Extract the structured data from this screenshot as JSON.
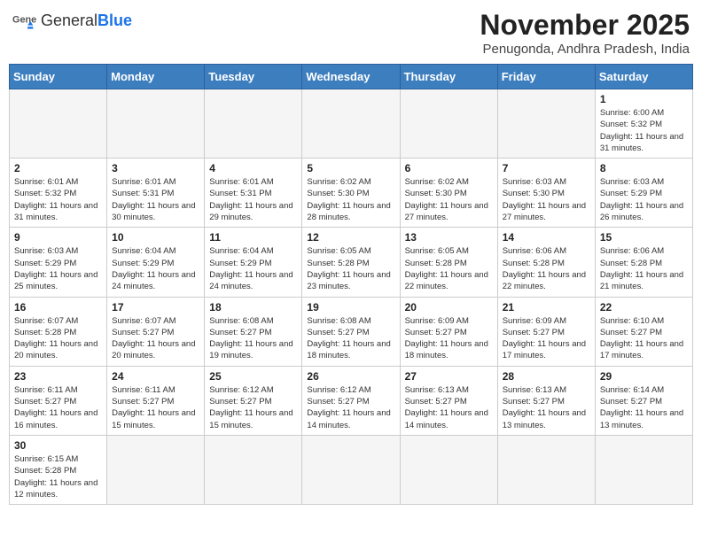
{
  "header": {
    "logo_general": "General",
    "logo_blue": "Blue",
    "month_title": "November 2025",
    "subtitle": "Penugonda, Andhra Pradesh, India"
  },
  "weekdays": [
    "Sunday",
    "Monday",
    "Tuesday",
    "Wednesday",
    "Thursday",
    "Friday",
    "Saturday"
  ],
  "weeks": [
    [
      {
        "day": null,
        "info": ""
      },
      {
        "day": null,
        "info": ""
      },
      {
        "day": null,
        "info": ""
      },
      {
        "day": null,
        "info": ""
      },
      {
        "day": null,
        "info": ""
      },
      {
        "day": null,
        "info": ""
      },
      {
        "day": "1",
        "info": "Sunrise: 6:00 AM\nSunset: 5:32 PM\nDaylight: 11 hours and 31 minutes."
      }
    ],
    [
      {
        "day": "2",
        "info": "Sunrise: 6:01 AM\nSunset: 5:32 PM\nDaylight: 11 hours and 31 minutes."
      },
      {
        "day": "3",
        "info": "Sunrise: 6:01 AM\nSunset: 5:31 PM\nDaylight: 11 hours and 30 minutes."
      },
      {
        "day": "4",
        "info": "Sunrise: 6:01 AM\nSunset: 5:31 PM\nDaylight: 11 hours and 29 minutes."
      },
      {
        "day": "5",
        "info": "Sunrise: 6:02 AM\nSunset: 5:30 PM\nDaylight: 11 hours and 28 minutes."
      },
      {
        "day": "6",
        "info": "Sunrise: 6:02 AM\nSunset: 5:30 PM\nDaylight: 11 hours and 27 minutes."
      },
      {
        "day": "7",
        "info": "Sunrise: 6:03 AM\nSunset: 5:30 PM\nDaylight: 11 hours and 27 minutes."
      },
      {
        "day": "8",
        "info": "Sunrise: 6:03 AM\nSunset: 5:29 PM\nDaylight: 11 hours and 26 minutes."
      }
    ],
    [
      {
        "day": "9",
        "info": "Sunrise: 6:03 AM\nSunset: 5:29 PM\nDaylight: 11 hours and 25 minutes."
      },
      {
        "day": "10",
        "info": "Sunrise: 6:04 AM\nSunset: 5:29 PM\nDaylight: 11 hours and 24 minutes."
      },
      {
        "day": "11",
        "info": "Sunrise: 6:04 AM\nSunset: 5:29 PM\nDaylight: 11 hours and 24 minutes."
      },
      {
        "day": "12",
        "info": "Sunrise: 6:05 AM\nSunset: 5:28 PM\nDaylight: 11 hours and 23 minutes."
      },
      {
        "day": "13",
        "info": "Sunrise: 6:05 AM\nSunset: 5:28 PM\nDaylight: 11 hours and 22 minutes."
      },
      {
        "day": "14",
        "info": "Sunrise: 6:06 AM\nSunset: 5:28 PM\nDaylight: 11 hours and 22 minutes."
      },
      {
        "day": "15",
        "info": "Sunrise: 6:06 AM\nSunset: 5:28 PM\nDaylight: 11 hours and 21 minutes."
      }
    ],
    [
      {
        "day": "16",
        "info": "Sunrise: 6:07 AM\nSunset: 5:28 PM\nDaylight: 11 hours and 20 minutes."
      },
      {
        "day": "17",
        "info": "Sunrise: 6:07 AM\nSunset: 5:27 PM\nDaylight: 11 hours and 20 minutes."
      },
      {
        "day": "18",
        "info": "Sunrise: 6:08 AM\nSunset: 5:27 PM\nDaylight: 11 hours and 19 minutes."
      },
      {
        "day": "19",
        "info": "Sunrise: 6:08 AM\nSunset: 5:27 PM\nDaylight: 11 hours and 18 minutes."
      },
      {
        "day": "20",
        "info": "Sunrise: 6:09 AM\nSunset: 5:27 PM\nDaylight: 11 hours and 18 minutes."
      },
      {
        "day": "21",
        "info": "Sunrise: 6:09 AM\nSunset: 5:27 PM\nDaylight: 11 hours and 17 minutes."
      },
      {
        "day": "22",
        "info": "Sunrise: 6:10 AM\nSunset: 5:27 PM\nDaylight: 11 hours and 17 minutes."
      }
    ],
    [
      {
        "day": "23",
        "info": "Sunrise: 6:11 AM\nSunset: 5:27 PM\nDaylight: 11 hours and 16 minutes."
      },
      {
        "day": "24",
        "info": "Sunrise: 6:11 AM\nSunset: 5:27 PM\nDaylight: 11 hours and 15 minutes."
      },
      {
        "day": "25",
        "info": "Sunrise: 6:12 AM\nSunset: 5:27 PM\nDaylight: 11 hours and 15 minutes."
      },
      {
        "day": "26",
        "info": "Sunrise: 6:12 AM\nSunset: 5:27 PM\nDaylight: 11 hours and 14 minutes."
      },
      {
        "day": "27",
        "info": "Sunrise: 6:13 AM\nSunset: 5:27 PM\nDaylight: 11 hours and 14 minutes."
      },
      {
        "day": "28",
        "info": "Sunrise: 6:13 AM\nSunset: 5:27 PM\nDaylight: 11 hours and 13 minutes."
      },
      {
        "day": "29",
        "info": "Sunrise: 6:14 AM\nSunset: 5:27 PM\nDaylight: 11 hours and 13 minutes."
      }
    ],
    [
      {
        "day": "30",
        "info": "Sunrise: 6:15 AM\nSunset: 5:28 PM\nDaylight: 11 hours and 12 minutes."
      },
      {
        "day": null,
        "info": ""
      },
      {
        "day": null,
        "info": ""
      },
      {
        "day": null,
        "info": ""
      },
      {
        "day": null,
        "info": ""
      },
      {
        "day": null,
        "info": ""
      },
      {
        "day": null,
        "info": ""
      }
    ]
  ]
}
